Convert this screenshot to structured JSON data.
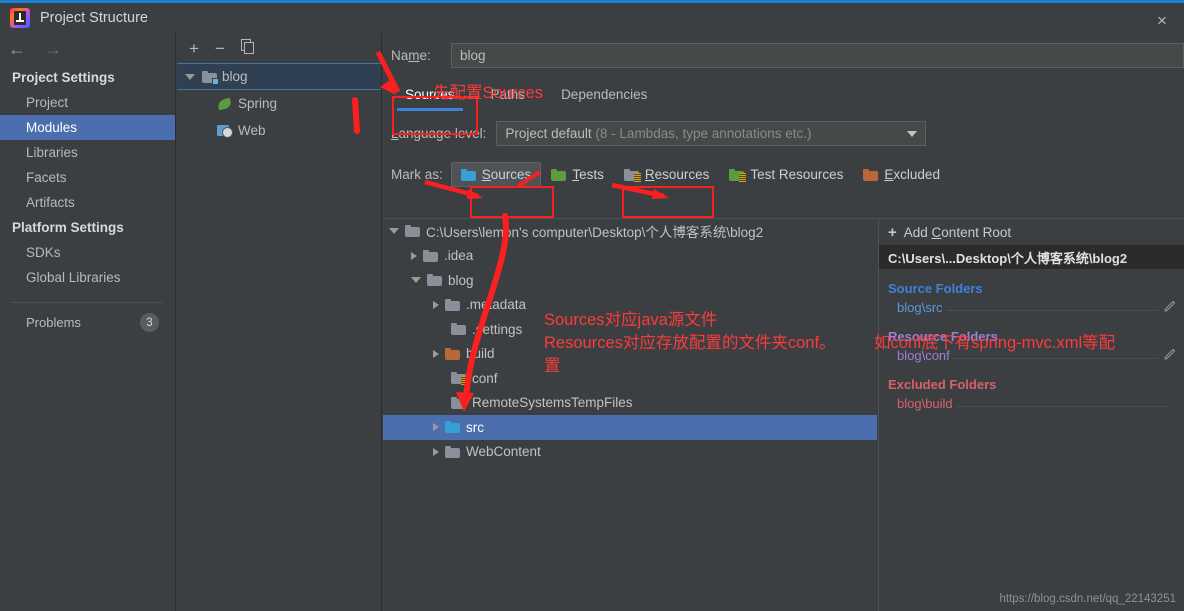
{
  "window": {
    "title": "Project Structure",
    "close_label": "×",
    "app_icon": "intellij-idea-logo"
  },
  "sidebar": {
    "nav": {
      "back": "←",
      "forward": "→"
    },
    "groups": [
      {
        "header": "Project Settings",
        "items": [
          {
            "label": "Project",
            "selected": false
          },
          {
            "label": "Modules",
            "selected": true
          },
          {
            "label": "Libraries",
            "selected": false
          },
          {
            "label": "Facets",
            "selected": false
          },
          {
            "label": "Artifacts",
            "selected": false
          }
        ]
      },
      {
        "header": "Platform Settings",
        "items": [
          {
            "label": "SDKs",
            "selected": false
          },
          {
            "label": "Global Libraries",
            "selected": false
          }
        ]
      }
    ],
    "problems": {
      "label": "Problems",
      "count": "3"
    }
  },
  "modules_panel": {
    "toolbar": {
      "add": "+",
      "remove": "−",
      "copy": "copy-icon"
    },
    "tree": [
      {
        "label": "blog",
        "icon": "module-folder-icon",
        "selected": true,
        "expanded": true,
        "depth": 0
      },
      {
        "label": "Spring",
        "icon": "spring-leaf-icon",
        "selected": false,
        "depth": 1
      },
      {
        "label": "Web",
        "icon": "web-facet-icon",
        "selected": false,
        "depth": 1
      }
    ]
  },
  "main": {
    "name_label": "Name:",
    "name_value": "blog",
    "tabs": [
      {
        "label": "Sources",
        "active": true
      },
      {
        "label": "Paths",
        "active": false
      },
      {
        "label": "Dependencies",
        "active": false
      }
    ],
    "language_level": {
      "label": "Language level:",
      "value": "Project default",
      "value_detail": "(8 - Lambdas, type annotations etc.)"
    },
    "mark_as": {
      "label": "Mark as:",
      "buttons": [
        {
          "label": "Sources",
          "mnemonic": "S",
          "icon": "blue-folder-icon",
          "pressed": true
        },
        {
          "label": "Tests",
          "mnemonic": "T",
          "icon": "green-folder-icon",
          "pressed": false
        },
        {
          "label": "Resources",
          "mnemonic": "R",
          "icon": "resources-folder-icon",
          "pressed": false
        },
        {
          "label": "Test Resources",
          "mnemonic": "",
          "icon": "test-resources-folder-icon",
          "pressed": false
        },
        {
          "label": "Excluded",
          "mnemonic": "E",
          "icon": "orange-folder-icon",
          "pressed": false
        }
      ]
    },
    "content_tree": [
      {
        "label": "C:\\Users\\lemon's computer\\Desktop\\个人博客系统\\blog2",
        "depth": 0,
        "arrow": "open",
        "folder": "gray",
        "selected": false
      },
      {
        "label": ".idea",
        "depth": 1,
        "arrow": "closed",
        "folder": "gray",
        "selected": false
      },
      {
        "label": "blog",
        "depth": 1,
        "arrow": "open",
        "folder": "gray",
        "selected": false
      },
      {
        "label": ".metadata",
        "depth": 2,
        "arrow": "closed",
        "folder": "gray",
        "selected": false
      },
      {
        "label": ".settings",
        "depth": 2,
        "arrow": "none",
        "folder": "gray",
        "selected": false
      },
      {
        "label": "build",
        "depth": 2,
        "arrow": "closed",
        "folder": "orange",
        "selected": false
      },
      {
        "label": "conf",
        "depth": 2,
        "arrow": "none",
        "folder": "resources",
        "selected": false
      },
      {
        "label": "RemoteSystemsTempFiles",
        "depth": 2,
        "arrow": "none",
        "folder": "gray",
        "selected": false
      },
      {
        "label": "src",
        "depth": 2,
        "arrow": "closed",
        "folder": "blue",
        "selected": true
      },
      {
        "label": "WebContent",
        "depth": 2,
        "arrow": "closed",
        "folder": "gray",
        "selected": false
      }
    ]
  },
  "details": {
    "add_content_root": "Add Content Root",
    "add_content_root_mnemonic": "C",
    "root_path": "C:\\Users\\...Desktop\\个人博客系统\\blog2",
    "groups": [
      {
        "title": "Source Folders",
        "kind": "src",
        "rows": [
          {
            "path": "blog\\src",
            "edit": "edit-pencil-icon"
          }
        ]
      },
      {
        "title": "Resource Folders",
        "kind": "res",
        "rows": [
          {
            "path": "blog\\conf",
            "edit": "edit-pencil-icon"
          }
        ]
      },
      {
        "title": "Excluded Folders",
        "kind": "exc",
        "rows": [
          {
            "path": "blog\\build",
            "edit": ""
          }
        ]
      }
    ]
  },
  "annotations": {
    "note_top": "先配置Sources",
    "note_mid_line1": "Sources对应java源文件",
    "note_mid_line2": "Resources对应存放配置的文件夹conf。",
    "note_mid_line3": "置",
    "note_right": "如conf底下有spring-mvc.xml等配",
    "color": "#fb3b3b"
  },
  "watermark": "https://blog.csdn.net/qq_22143251"
}
